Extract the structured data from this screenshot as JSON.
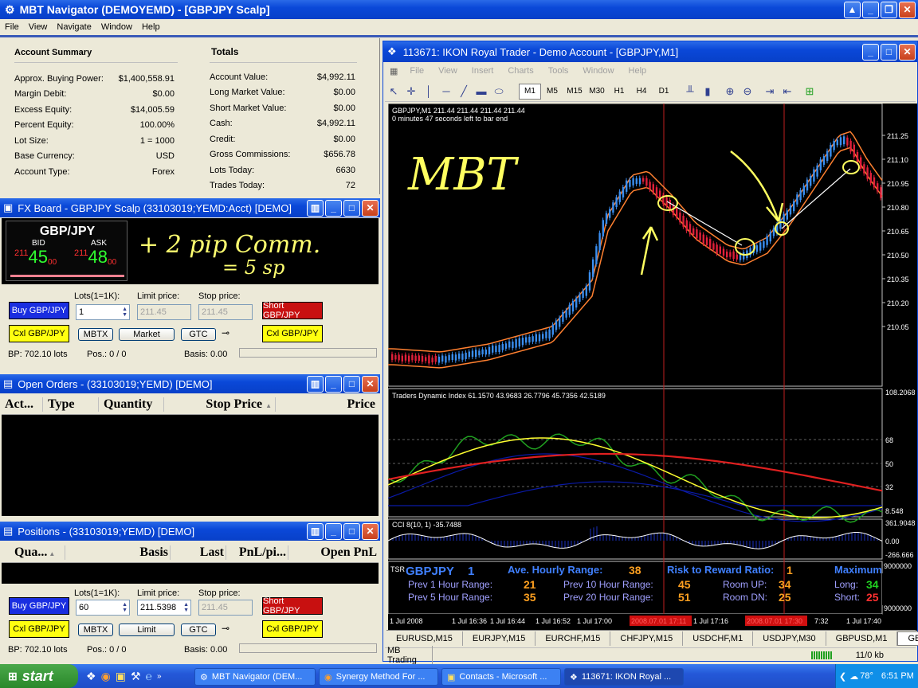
{
  "app": {
    "title": "MBT Navigator (DEMOYEMD) - [GBPJPY Scalp]",
    "menu": [
      "File",
      "View",
      "Navigate",
      "Window",
      "Help"
    ]
  },
  "account_summary": {
    "title": "Account Summary",
    "rows": [
      {
        "label": "Approx. Buying Power:",
        "value": "$1,400,558.91"
      },
      {
        "label": "Margin Debit:",
        "value": "$0.00"
      },
      {
        "label": "Excess Equity:",
        "value": "$14,005.59"
      },
      {
        "label": "Percent Equity:",
        "value": "100.00%"
      },
      {
        "label": "Lot Size:",
        "value": "1 = 1000"
      },
      {
        "label": "Base Currency:",
        "value": "USD"
      },
      {
        "label": "Account Type:",
        "value": "Forex"
      }
    ]
  },
  "totals": {
    "title": "Totals",
    "rows": [
      {
        "label": "Account Value:",
        "value": "$4,992.11"
      },
      {
        "label": "Long Market Value:",
        "value": "$0.00"
      },
      {
        "label": "Short Market Value:",
        "value": "$0.00"
      },
      {
        "label": "Cash:",
        "value": "$4,992.11"
      },
      {
        "label": "Credit:",
        "value": "$0.00"
      },
      {
        "label": "Gross Commissions:",
        "value": "$656.78"
      },
      {
        "label": "Lots Today:",
        "value": "6630"
      },
      {
        "label": "Trades Today:",
        "value": "72"
      }
    ]
  },
  "fxboard": {
    "title": "FX Board - GBPJPY Scalp (33103019;YEMD:Acct) [DEMO]",
    "pair": "GBP/JPY",
    "bid_label": "BID",
    "ask_label": "ASK",
    "bid_pre": "211",
    "bid_big": "45",
    "bid_sub": "00",
    "ask_pre": "211",
    "ask_big": "48",
    "ask_sub": "00",
    "annotation_line1": "+ 2 pip Comm.",
    "annotation_line2": "= 5 sp",
    "lots_label": "Lots(1=1K):",
    "limit_label": "Limit price:",
    "stop_label": "Stop price:",
    "lots_value": "1",
    "limit_value": "211.45",
    "stop_value": "211.45",
    "buy_label": "Buy GBP/JPY",
    "short_label": "Short GBP/JPY",
    "cxl_left": "Cxl GBP/JPY",
    "cxl_right": "Cxl GBP/JPY",
    "mbtx": "MBTX",
    "market": "Market",
    "gtc": "GTC",
    "bp": "BP: 702.10 lots",
    "pos": "Pos.: 0 / 0",
    "basis": "Basis: 0.00"
  },
  "open_orders": {
    "title": "Open Orders - (33103019;YEMD) [DEMO]",
    "columns": [
      "Act...",
      "Type",
      "Quantity",
      "Stop Price",
      "Price"
    ]
  },
  "positions": {
    "title": "Positions - (33103019;YEMD) [DEMO]",
    "columns": [
      "Qua...",
      "Basis",
      "Last",
      "PnL/pi...",
      "Open PnL"
    ],
    "lots_label": "Lots(1=1K):",
    "limit_label": "Limit price:",
    "stop_label": "Stop price:",
    "lots_value": "60",
    "limit_value": "211.5398",
    "stop_value": "211.45",
    "buy_label": "Buy GBP/JPY",
    "short_label": "Short GBP/JPY",
    "cxl_left": "Cxl GBP/JPY",
    "cxl_right": "Cxl GBP/JPY",
    "mbtx": "MBTX",
    "limit_btn": "Limit",
    "gtc": "GTC",
    "bp": "BP: 702.10 lots",
    "pos": "Pos.: 0 / 0",
    "basis": "Basis: 0.00"
  },
  "mt4": {
    "title": "113671: IKON Royal Trader - Demo Account - [GBPJPY,M1]",
    "menu": [
      "File",
      "View",
      "Insert",
      "Charts",
      "Tools",
      "Window",
      "Help"
    ],
    "timeframes": [
      "M1",
      "M5",
      "M15",
      "M30",
      "H1",
      "H4",
      "D1"
    ],
    "chart_header": "GBPJPY,M1  211.44 211.44 211.44 211.44",
    "chart_timer": "0 minutes 47 seconds left to bar end",
    "annotation_mbt": "MBT",
    "price_ticks": [
      "211.25",
      "211.10",
      "210.95",
      "210.80",
      "210.65",
      "210.50",
      "210.35",
      "210.20",
      "210.05"
    ],
    "tdi_label": "Traders Dynamic Index 61.1570 43.9683 26.7796 45.7356 42.5189",
    "tdi_ticks": [
      "108.2068",
      "68",
      "50",
      "32",
      "8.548"
    ],
    "cci_label": "CCI 8(10, 1) -35.7488",
    "cci_ticks": [
      "361.9048",
      "0.00",
      "-266.666"
    ],
    "tsr_ticks": [
      "9000000",
      "9000000"
    ],
    "time_ticks": [
      "1 Jul 2008",
      "1 Jul 16:36",
      "1 Jul 16:44",
      "1 Jul 16:52",
      "1 Jul 17:00",
      "2008.07.01 17:11",
      "1 Jul 17:16",
      "2008.07.01 17:30",
      "7:32",
      "1 Jul 17:40"
    ],
    "tabs": [
      "EURUSD,M15",
      "EURJPY,M15",
      "EURCHF,M15",
      "CHFJPY,M15",
      "USDCHF,M1",
      "USDJPY,M30",
      "GBPUSD,M1",
      "GBPJ"
    ],
    "status_left": "MB Trading",
    "status_right": "11/0 kb",
    "tsr": {
      "tag": "TSR",
      "symbol": "GBPJPY",
      "tf": "1",
      "avg_label": "Ave. Hourly Range:",
      "avg_value": "38",
      "rr_label": "Risk to Reward Ratio:",
      "rr_value": "1",
      "max_label": "Maximum",
      "p1_label": "Prev 1 Hour Range:",
      "p1_value": "21",
      "p5_label": "Prev 5 Hour Range:",
      "p5_value": "35",
      "p10_label": "Prev 10 Hour Range:",
      "p10_value": "45",
      "p20_label": "Prev 20 Hour Range:",
      "p20_value": "51",
      "up_label": "Room UP:",
      "up_value": "34",
      "dn_label": "Room DN:",
      "dn_value": "25",
      "long_label": "Long:",
      "long_value": "34",
      "short_label": "Short:",
      "short_value": "25"
    }
  },
  "taskbar": {
    "start": "start",
    "items": [
      "MBT Navigator (DEM...",
      "Synergy Method For ...",
      "Contacts - Microsoft ...",
      "113671: IKON Royal ..."
    ],
    "temp": "78°",
    "clock": "6:51 PM"
  },
  "colors": {
    "xp_blue": "#0a48d8",
    "bull": "#3a8ef0",
    "bear": "#e0203a",
    "band": "#ff8030",
    "annotation": "#ffff60"
  }
}
